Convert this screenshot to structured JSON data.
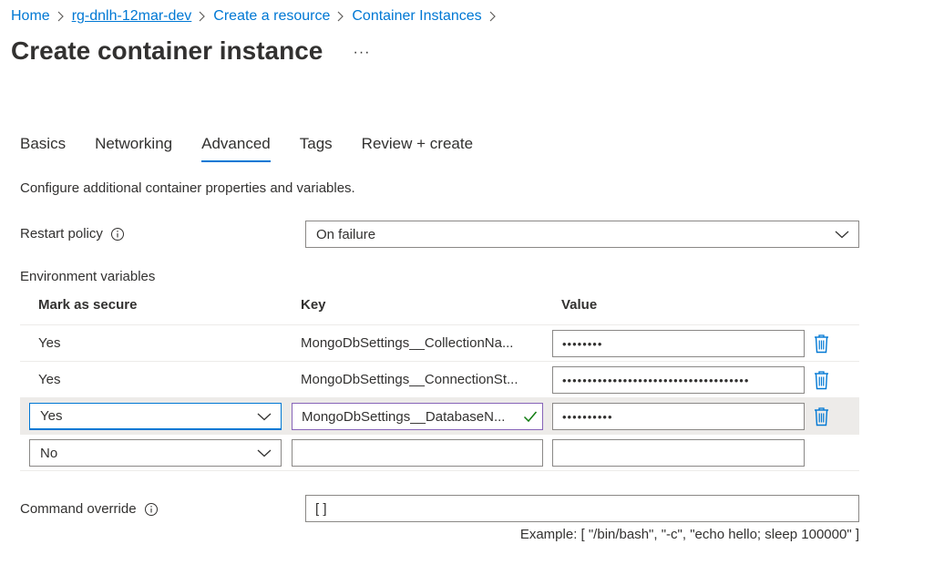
{
  "breadcrumb": {
    "items": [
      {
        "label": "Home"
      },
      {
        "label": "rg-dnlh-12mar-dev"
      },
      {
        "label": "Create a resource"
      },
      {
        "label": "Container Instances"
      }
    ]
  },
  "page": {
    "title": "Create container instance",
    "more_label": "···"
  },
  "tabs": [
    {
      "label": "Basics",
      "active": false
    },
    {
      "label": "Networking",
      "active": false
    },
    {
      "label": "Advanced",
      "active": true
    },
    {
      "label": "Tags",
      "active": false
    },
    {
      "label": "Review + create",
      "active": false
    }
  ],
  "description": "Configure additional container properties and variables.",
  "restart_policy": {
    "label": "Restart policy",
    "value": "On failure"
  },
  "env": {
    "label": "Environment variables",
    "columns": {
      "secure": "Mark as secure",
      "key": "Key",
      "value": "Value"
    },
    "rows": [
      {
        "secure": "Yes",
        "key": "MongoDbSettings__CollectionNa...",
        "value": "••••••••"
      },
      {
        "secure": "Yes",
        "key": "MongoDbSettings__ConnectionSt...",
        "value": "•••••••••••••••••••••••••••••••••••••"
      },
      {
        "secure": "Yes",
        "key": "MongoDbSettings__DatabaseN...",
        "value": "••••••••••"
      },
      {
        "secure": "No",
        "key": "",
        "value": ""
      }
    ]
  },
  "command_override": {
    "label": "Command override",
    "value": "[ ]",
    "example": "Example: [ \"/bin/bash\", \"-c\", \"echo hello; sleep 100000\" ]"
  },
  "colors": {
    "link": "#0078d4",
    "accent": "#0078d4",
    "text": "#323130",
    "valid": "#107c10",
    "selected_row": "#edebe9"
  },
  "icons": {
    "breadcrumb_separator": "chevron-right-icon",
    "info": "info-icon",
    "dropdown": "chevron-down-icon",
    "delete": "trash-icon",
    "valid": "checkmark-icon"
  }
}
